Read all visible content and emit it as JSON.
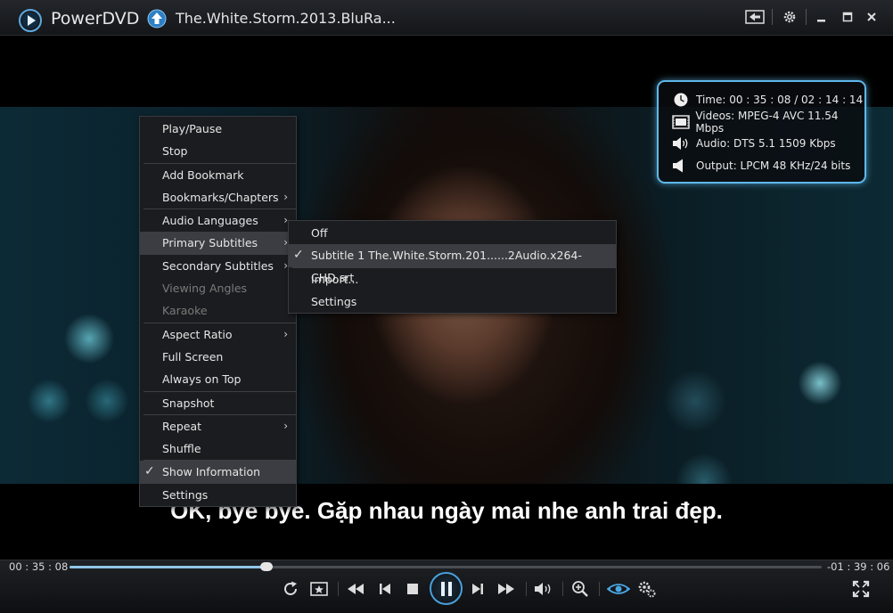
{
  "window": {
    "app_name": "PowerDVD",
    "title": "The.White.Storm.2013.BluRa..."
  },
  "info_panel": {
    "time": "Time: 00 : 35 : 08 / 02 : 14 : 14",
    "video": "Videos: MPEG-4 AVC  11.54 Mbps",
    "audio": "Audio: DTS 5.1  1509 Kbps",
    "output": "Output: LPCM 48 KHz/24 bits"
  },
  "subtitle": "OK, bye bye. Gặp nhau ngày mai nhe anh trai đẹp.",
  "context_menu": {
    "items": [
      {
        "label": "Play/Pause"
      },
      {
        "label": "Stop"
      },
      {
        "label": "Add Bookmark"
      },
      {
        "label": "Bookmarks/Chapters"
      },
      {
        "label": "Audio Languages"
      },
      {
        "label": "Primary Subtitles"
      },
      {
        "label": "Secondary Subtitles"
      },
      {
        "label": "Viewing Angles"
      },
      {
        "label": "Karaoke"
      },
      {
        "label": "Aspect Ratio"
      },
      {
        "label": "Full Screen"
      },
      {
        "label": "Always on Top"
      },
      {
        "label": "Snapshot"
      },
      {
        "label": "Repeat"
      },
      {
        "label": "Shuffle"
      },
      {
        "label": "Show Information"
      },
      {
        "label": "Settings"
      }
    ]
  },
  "subtitle_submenu": {
    "items": [
      {
        "label": "Off"
      },
      {
        "label": "Subtitle 1 The.White.Storm.201......2Audio.x264-CHD.srt"
      },
      {
        "label": "Import..."
      },
      {
        "label": "Settings"
      }
    ]
  },
  "playback": {
    "elapsed": "00 : 35 : 08",
    "remaining": "-01 : 39 : 06",
    "progress": 0.262
  },
  "colors": {
    "accent": "#4a9fd8",
    "info_border": "#5fb7ea"
  }
}
